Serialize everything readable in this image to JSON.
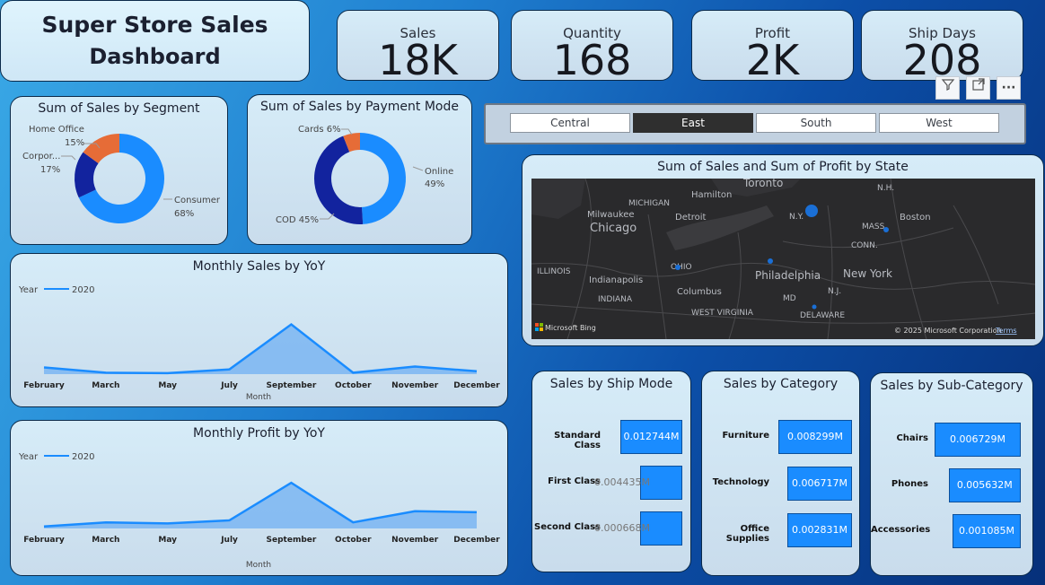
{
  "dashboard": {
    "title_line1": "Super Store Sales",
    "title_line2": "Dashboard"
  },
  "kpis": [
    {
      "label": "Sales",
      "value": "18K"
    },
    {
      "label": "Quantity",
      "value": "168"
    },
    {
      "label": "Profit",
      "value": "2K"
    },
    {
      "label": "Ship Days",
      "value": "208"
    }
  ],
  "toolbar": {
    "filter_icon": "filter-icon",
    "focus_icon": "focus-mode-icon",
    "more_icon": "more-options-icon",
    "more_label": "···"
  },
  "slicer": {
    "options": [
      "Central",
      "East",
      "South",
      "West"
    ],
    "selected": "East"
  },
  "segment_chart": {
    "title": "Sum of Sales by Segment",
    "labels": {
      "home_office": "Home Office",
      "home_office_pct": "15%",
      "corporate": "Corpor...",
      "corporate_pct": "17%",
      "consumer": "Consumer",
      "consumer_pct": "68%"
    }
  },
  "payment_chart": {
    "title": "Sum of Sales by Payment Mode",
    "labels": {
      "cards": "Cards 6%",
      "online": "Online",
      "online_pct": "49%",
      "cod": "COD 45%"
    }
  },
  "map_card": {
    "title": "Sum of Sales and Sum of Profit by State",
    "places": {
      "toronto": "Toronto",
      "hamilton": "Hamilton",
      "michigan": "MICHIGAN",
      "milwaukee": "Milwaukee",
      "detroit": "Detroit",
      "chicago": "Chicago",
      "ny": "N.Y.",
      "nh": "N.H.",
      "mass": "MASS.",
      "boston": "Boston",
      "conn": "CONN.",
      "ohio": "OHIO",
      "illinois": "ILLINOIS",
      "indianapolis": "Indianapolis",
      "philadelphia": "Philadelphia",
      "newyork": "New York",
      "indiana": "INDIANA",
      "columbus": "Columbus",
      "md": "MD",
      "nj": "N.J.",
      "westvirginia": "WEST VIRGINIA",
      "delaware": "DELAWARE"
    },
    "brand": "Microsoft Bing",
    "copyright": "© 2025 Microsoft Corporation",
    "terms": "Terms"
  },
  "chart_data": [
    {
      "type": "line",
      "title": "Monthly Sales by YoY",
      "xlabel": "Month",
      "legend_title": "Year",
      "categories": [
        "February",
        "March",
        "May",
        "July",
        "September",
        "October",
        "November",
        "December"
      ],
      "series": [
        {
          "name": "2020",
          "values": [
            0.7,
            0.15,
            0.1,
            0.5,
            5.2,
            0.15,
            0.8,
            0.3
          ]
        }
      ],
      "ylim": [
        0,
        6
      ]
    },
    {
      "type": "line",
      "title": "Monthly Profit by YoY",
      "xlabel": "Month",
      "legend_title": "Year",
      "categories": [
        "February",
        "March",
        "May",
        "July",
        "September",
        "October",
        "November",
        "December"
      ],
      "series": [
        {
          "name": "2020",
          "values": [
            -0.1,
            0.3,
            0.2,
            0.5,
            4.2,
            0.3,
            1.4,
            1.3
          ]
        }
      ],
      "ylim": [
        -0.3,
        5
      ]
    },
    {
      "type": "pie",
      "title": "Sum of Sales by Segment",
      "categories": [
        "Consumer",
        "Corporate",
        "Home Office"
      ],
      "values": [
        68,
        17,
        15
      ],
      "colors": [
        "#1a8cff",
        "#12239e",
        "#e66c37"
      ]
    },
    {
      "type": "pie",
      "title": "Sum of Sales by Payment Mode",
      "categories": [
        "Online",
        "COD",
        "Cards"
      ],
      "values": [
        49,
        45,
        6
      ],
      "colors": [
        "#1a8cff",
        "#12239e",
        "#e66c37"
      ]
    },
    {
      "type": "bar",
      "title": "Sales by Ship Mode",
      "categories": [
        "Standard Class",
        "First Class",
        "Second Class"
      ],
      "values": [
        0.012744,
        0.004435,
        0.000668
      ],
      "labels": [
        "0.012744M",
        "0.004435M",
        "0.000668M"
      ]
    },
    {
      "type": "bar",
      "title": "Sales by Category",
      "categories": [
        "Furniture",
        "Technology",
        "Office Supplies"
      ],
      "values": [
        0.008299,
        0.006717,
        0.002831
      ],
      "labels": [
        "0.008299M",
        "0.006717M",
        "0.002831M"
      ]
    },
    {
      "type": "bar",
      "title": "Sales by Sub-Category",
      "categories": [
        "Chairs",
        "Phones",
        "Accessories"
      ],
      "values": [
        0.006729,
        0.005632,
        0.001085
      ],
      "labels": [
        "0.006729M",
        "0.005632M",
        "0.001085M"
      ]
    }
  ]
}
